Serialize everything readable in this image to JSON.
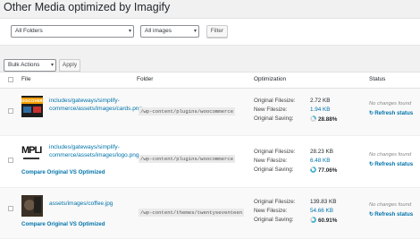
{
  "page": {
    "title": "Other Media optimized by Imagify"
  },
  "filters": {
    "folders_selected": "All Folders",
    "type_selected": "All images",
    "filter_label": "Filter"
  },
  "bulk": {
    "action_selected": "Bulk Actions",
    "apply_label": "Apply"
  },
  "table": {
    "columns": {
      "file": "File",
      "folder": "Folder",
      "optimization": "Optimization",
      "status": "Status"
    },
    "labels": {
      "original_filesize": "Original Filesize:",
      "new_filesize": "New Filesize:",
      "original_saving": "Original Saving:"
    },
    "rows": [
      {
        "file_path": "includes/gateways/simplify-commerce/assets/images/cards.png",
        "folder": "/wp-content/plugins/woocommerce",
        "original_filesize": "2.72 KB",
        "new_filesize": "1.94 KB",
        "saving": "28.88%",
        "saving_fraction": 0.2888,
        "status_note": "No changes found",
        "refresh_label": "Refresh status",
        "compare_label": "",
        "thumb_text": "DISCOVER"
      },
      {
        "file_path": "includes/gateways/simplify-commerce/assets/images/logo.png",
        "folder": "/wp-content/plugins/woocommerce",
        "original_filesize": "28.23 KB",
        "new_filesize": "6.48 KB",
        "saving": "77.06%",
        "saving_fraction": 0.7706,
        "status_note": "No changes found",
        "refresh_label": "Refresh status",
        "compare_label": "Compare Original VS Optimized",
        "thumb_text": "MPLI"
      },
      {
        "file_path": "assets/images/coffee.jpg",
        "folder": "/wp-content/themes/twentyseventeen",
        "original_filesize": "139.83 KB",
        "new_filesize": "54.66 KB",
        "saving": "60.91%",
        "saving_fraction": 0.6091,
        "status_note": "No changes found",
        "refresh_label": "Refresh status",
        "compare_label": "Compare Original VS Optimized",
        "thumb_text": ""
      }
    ]
  },
  "colors": {
    "accent": "#0073aa",
    "donut_fill": "#40b1d0",
    "donut_track": "#d6d6d6"
  },
  "icons": {
    "refresh": "refresh-icon",
    "dropdown": "chevron-down-icon"
  }
}
